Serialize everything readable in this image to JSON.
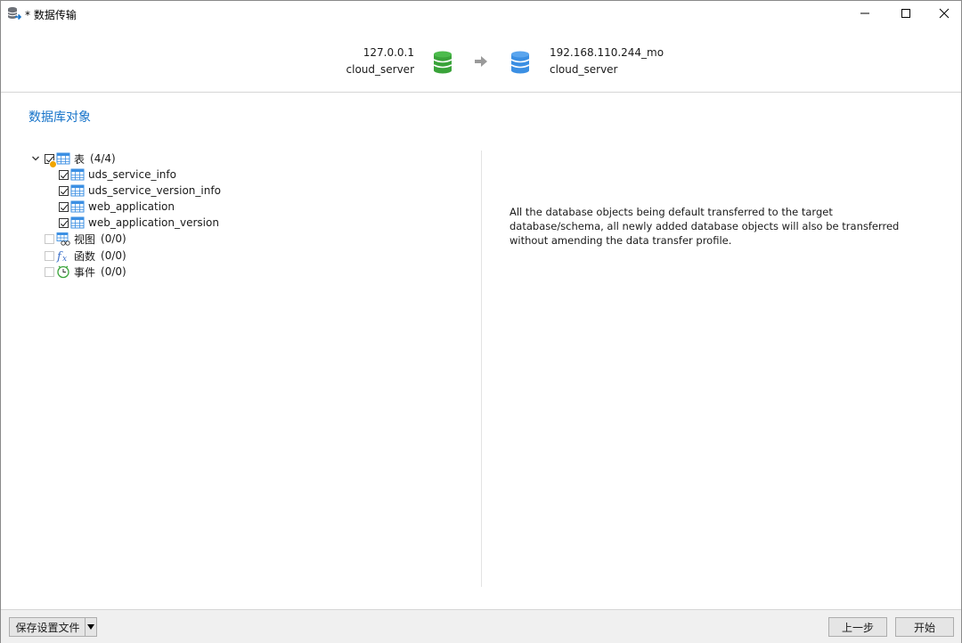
{
  "window": {
    "title": "* 数据传输",
    "icon": "db-transfer-icon"
  },
  "connection": {
    "source": {
      "host": "127.0.0.1",
      "name": "cloud_server",
      "icon": "green-database-icon",
      "color": "#3aa33a"
    },
    "target": {
      "host": "192.168.110.244_mo",
      "name": "cloud_server",
      "icon": "blue-database-icon",
      "color": "#3b8fe3"
    },
    "arrow_icon": "arrow-right-icon"
  },
  "section": {
    "title": "数据库对象"
  },
  "tree": {
    "tables": {
      "label": "表",
      "count": "(4/4)",
      "expanded": true,
      "checked": true,
      "items": [
        {
          "label": "uds_service_info",
          "checked": true
        },
        {
          "label": "uds_service_version_info",
          "checked": true
        },
        {
          "label": "web_application",
          "checked": true
        },
        {
          "label": "web_application_version",
          "checked": true
        }
      ]
    },
    "views": {
      "label": "视图",
      "count": "(0/0)",
      "checked": false
    },
    "functions": {
      "label": "函数",
      "count": "(0/0)",
      "checked": false
    },
    "events": {
      "label": "事件",
      "count": "(0/0)",
      "checked": false
    }
  },
  "info": {
    "text": "All the database objects being default transferred to the target database/schema, all newly added database objects will also be transferred without amending the data transfer profile."
  },
  "footer": {
    "save_label": "保存设置文件",
    "prev_label": "上一步",
    "start_label": "开始"
  },
  "colors": {
    "accent": "#1673c9",
    "partial_dot": "#f0a500"
  }
}
